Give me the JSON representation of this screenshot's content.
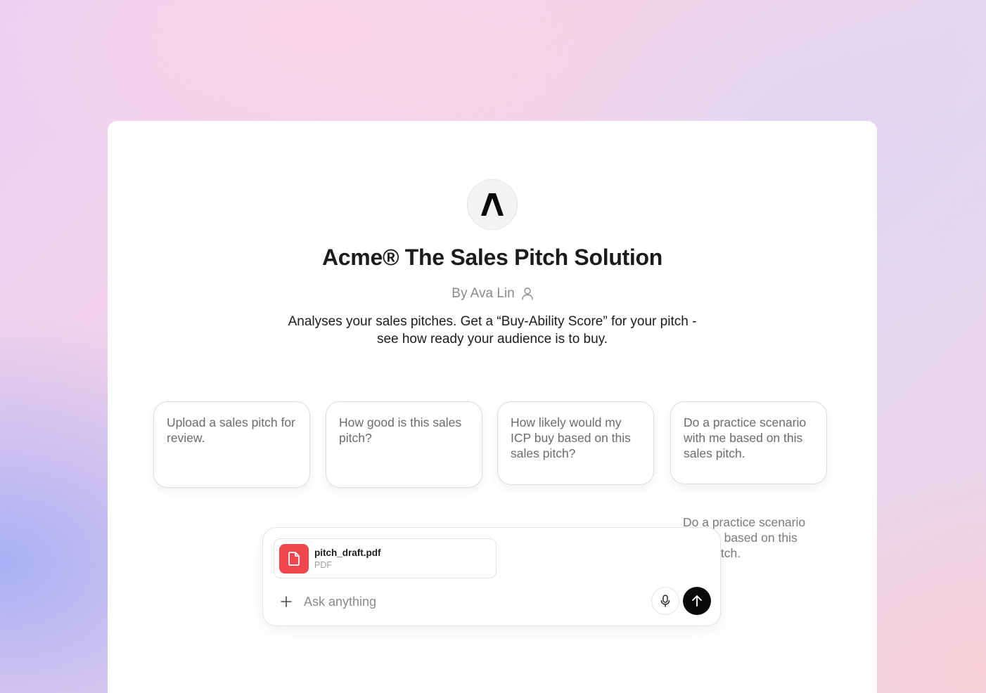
{
  "app": {
    "title": "Acme® The Sales Pitch Solution",
    "author": "By Ava Lin",
    "description_line1": "Analyses your sales pitches. Get a “Buy-Ability Score” for your pitch -",
    "description_line2": "see how ready your audience is to buy."
  },
  "suggestions": [
    {
      "label": "Upload a sales pitch for review."
    },
    {
      "label": "How good is this sales pitch?"
    },
    {
      "label": "How likely would my ICP buy based on this sales pitch?"
    },
    {
      "label": "Do a practice scenario with me based on this sales pitch."
    }
  ],
  "ghost_suggestion": {
    "line1": "Do a practice scenario",
    "line2": "e based on this",
    "line3": "itch."
  },
  "composer": {
    "attachment": {
      "name": "pitch_draft.pdf",
      "type": "PDF"
    },
    "placeholder": "Ask anything"
  },
  "icons": {
    "logo": "acme-logo",
    "author": "user-icon",
    "file": "file-icon",
    "add": "plus-icon",
    "mic": "microphone-icon",
    "send": "arrow-up-icon"
  },
  "colors": {
    "file_badge": "#f0464d",
    "send_button": "#0a0a0a"
  }
}
